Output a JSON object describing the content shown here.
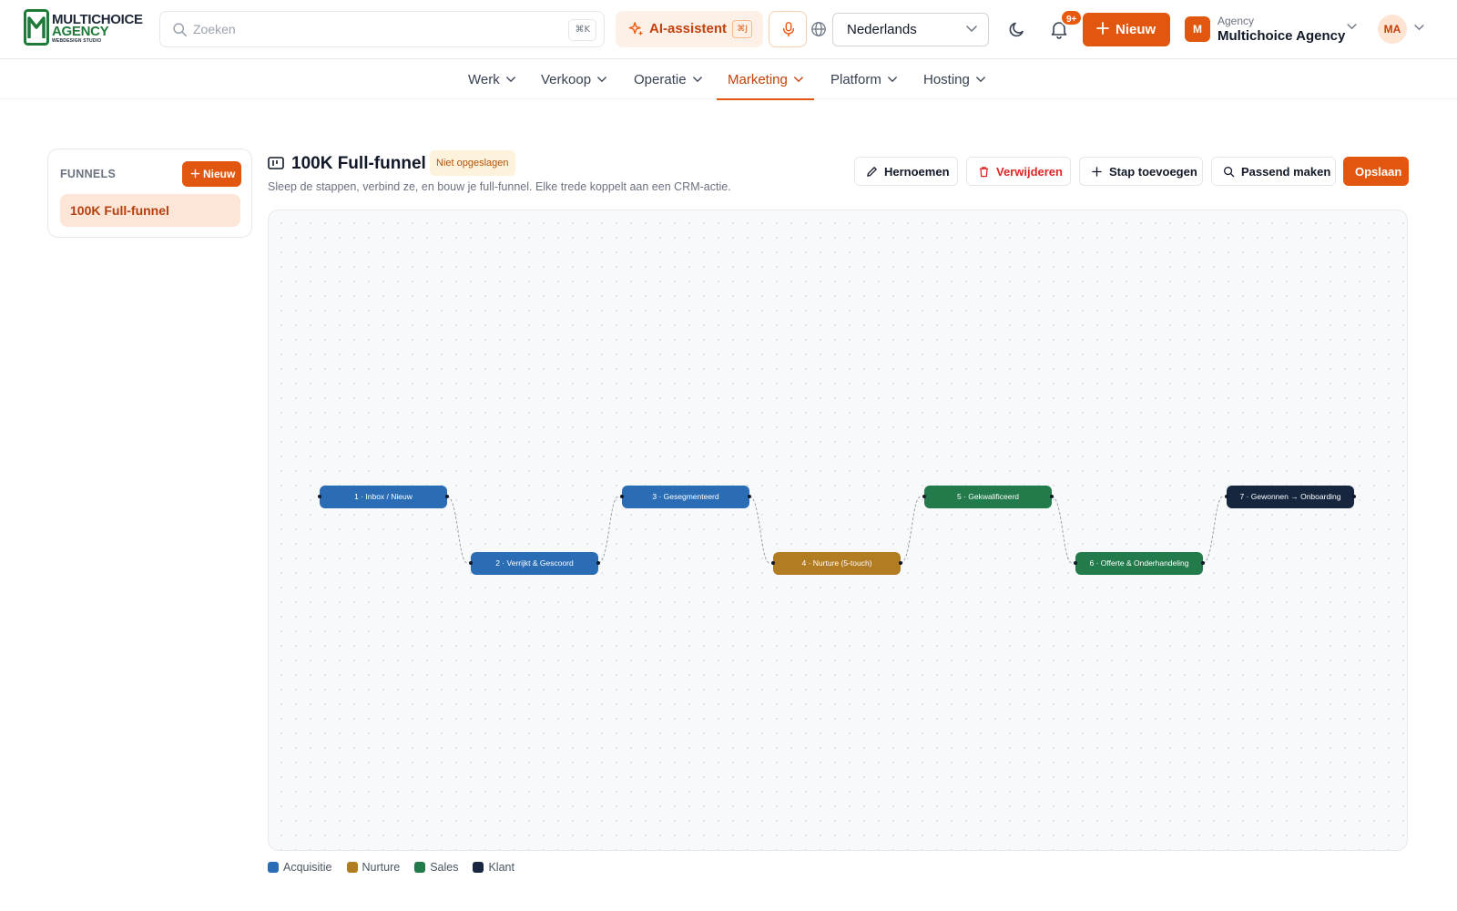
{
  "brand": {
    "logo_line1": "MULTICHOICE",
    "logo_line2": "AGENCY",
    "logo_line3": "WEBDESIGN STUDIO"
  },
  "header": {
    "search_placeholder": "Zoeken",
    "search_shortcut": "⌘K",
    "ai_label": "AI-assistent",
    "ai_shortcut": "⌘J",
    "language": "Nederlands",
    "notification_count": "9+",
    "new_label": "Nieuw",
    "agency_label": "Agency",
    "agency_name": "Multichoice Agency",
    "agency_initial": "M",
    "user_initials": "MA"
  },
  "nav": {
    "items": [
      {
        "label": "Werk",
        "active": false
      },
      {
        "label": "Verkoop",
        "active": false
      },
      {
        "label": "Operatie",
        "active": false
      },
      {
        "label": "Marketing",
        "active": true
      },
      {
        "label": "Platform",
        "active": false
      },
      {
        "label": "Hosting",
        "active": false
      }
    ]
  },
  "sidebar": {
    "title": "FUNNELS",
    "new_label": "Nieuw",
    "items": [
      {
        "label": "100K Full-funnel",
        "selected": true
      }
    ]
  },
  "funnel": {
    "title": "100K Full-funnel",
    "status": "Niet opgeslagen",
    "subtitle": "Sleep de stappen, verbind ze, en bouw je full-funnel. Elke trede koppelt aan een CRM-actie.",
    "actions": {
      "rename": "Hernoemen",
      "delete": "Verwijderen",
      "add_step": "Stap toevoegen",
      "fit": "Passend maken",
      "save": "Opslaan"
    },
    "steps": [
      {
        "label": "1 · Inbox / Nieuw",
        "category": "Acquisitie"
      },
      {
        "label": "2 · Verrijkt & Gescoord",
        "category": "Acquisitie"
      },
      {
        "label": "3 · Gesegmenteerd",
        "category": "Acquisitie"
      },
      {
        "label": "4 · Nurture (5-touch)",
        "category": "Nurture"
      },
      {
        "label": "5 · Gekwalificeerd",
        "category": "Sales"
      },
      {
        "label": "6 · Offerte & Onderhandeling",
        "category": "Sales"
      },
      {
        "label": "7 · Gewonnen → Onboarding",
        "category": "Klant"
      }
    ]
  },
  "legend": [
    {
      "label": "Acquisitie",
      "color": "#2a6db5"
    },
    {
      "label": "Nurture",
      "color": "#b27c22"
    },
    {
      "label": "Sales",
      "color": "#237a4b"
    },
    {
      "label": "Klant",
      "color": "#16263f"
    }
  ],
  "colors": {
    "accent": "#e2570f",
    "acquisitie": "#2a6db5",
    "nurture": "#b27c22",
    "sales": "#237a4b",
    "klant": "#16263f"
  }
}
